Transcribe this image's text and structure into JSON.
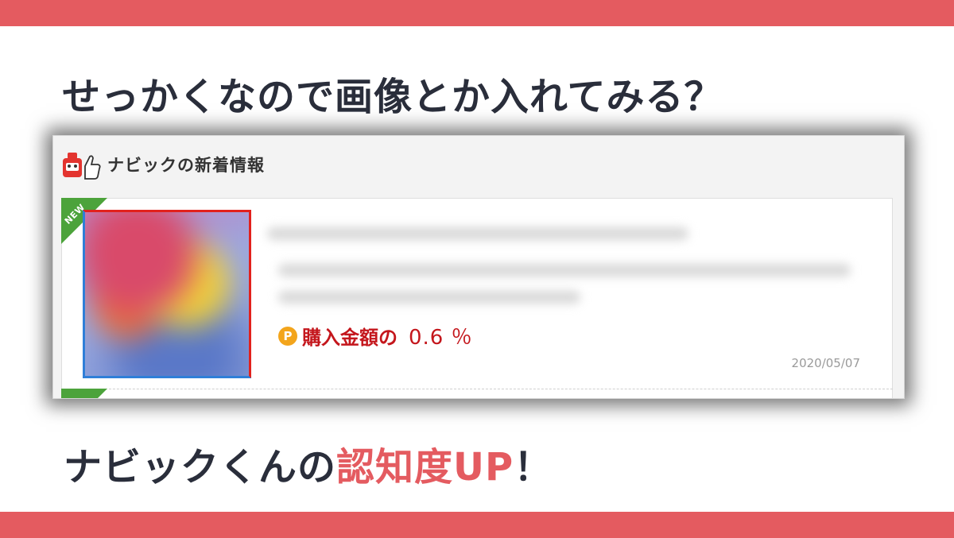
{
  "slide": {
    "headline": "せっかくなので画像とか入れてみる？",
    "tagline_prefix": "ナビックくんの",
    "tagline_accent": "認知度UP",
    "tagline_suffix": "！",
    "colors": {
      "band": "#e45b60",
      "accent": "#e45b60",
      "price": "#c4161c",
      "new_ribbon": "#4ca33b"
    }
  },
  "widget": {
    "title": "ナビックの新着情報",
    "logo_icon": "navic-thumbs-up-mascot-icon",
    "item": {
      "badge": "NEW",
      "point_icon_label": "P",
      "point_label": "購入金額の",
      "point_value": "0.6 ％",
      "date": "2020/05/07"
    }
  }
}
